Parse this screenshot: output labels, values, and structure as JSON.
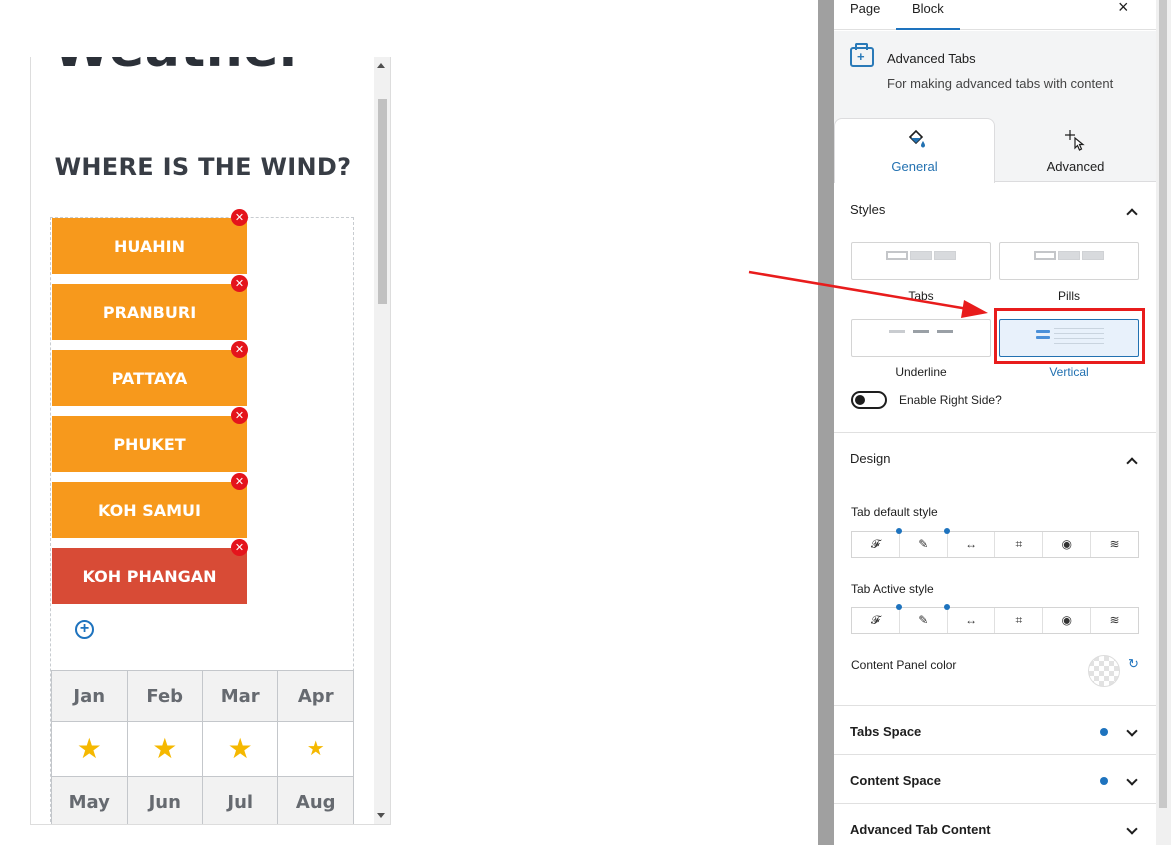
{
  "preview": {
    "page_title": "Weather",
    "heading": "WHERE IS THE WIND?",
    "tabs": [
      {
        "label": "HUAHIN",
        "active": false
      },
      {
        "label": "PRANBURI",
        "active": false
      },
      {
        "label": "PATTAYA",
        "active": false
      },
      {
        "label": "PHUKET",
        "active": false
      },
      {
        "label": "KOH SAMUI",
        "active": false
      },
      {
        "label": "KOH PHANGAN",
        "active": true
      }
    ],
    "remove_glyph": "✕",
    "add_glyph": "+",
    "months_row1": [
      "Jan",
      "Feb",
      "Mar",
      "Apr"
    ],
    "stars_row1": [
      "★",
      "★",
      "★",
      "★"
    ],
    "months_row2": [
      "May",
      "Jun",
      "Jul",
      "Aug"
    ]
  },
  "sidebar": {
    "top_tabs": {
      "page": "Page",
      "block": "Block",
      "close": "×"
    },
    "block": {
      "title": "Advanced Tabs",
      "description": "For making advanced tabs with content",
      "icon": "tabs-plus-icon"
    },
    "panel_tabs": {
      "general": "General",
      "advanced": "Advanced"
    },
    "styles": {
      "title": "Styles",
      "options": {
        "tabs": "Tabs",
        "pills": "Pills",
        "underline": "Underline",
        "vertical": "Vertical"
      },
      "selected": "vertical",
      "enable_right_side": "Enable Right Side?"
    },
    "design": {
      "title": "Design",
      "tab_default_style": "Tab default style",
      "tab_active_style": "Tab Active style",
      "icons": [
        "𝓕",
        "✎",
        "↔",
        "⌗",
        "◉",
        "≋"
      ],
      "content_panel_color": "Content Panel color",
      "reset_glyph": "↻"
    },
    "sections": {
      "tabs_space": "Tabs Space",
      "content_space": "Content Space",
      "advanced_tab_content": "Advanced Tab Content"
    }
  },
  "colors": {
    "tab_orange": "#f7991c",
    "tab_active_red": "#d84b36",
    "accent_blue": "#2271b1",
    "annotation_red": "#e81c1c"
  }
}
